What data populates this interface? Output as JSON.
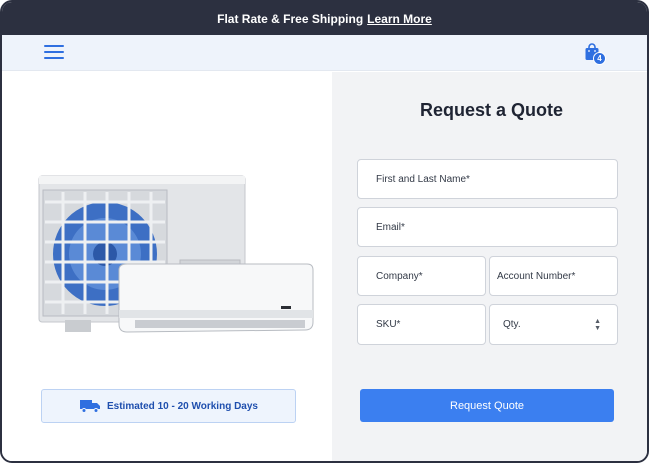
{
  "announcement": {
    "text": "Flat Rate & Free Shipping",
    "link": "Learn More"
  },
  "nav": {
    "menu_icon": "hamburger-menu-icon",
    "cart_icon": "shopping-bag-icon",
    "cart_count": "4",
    "accent_color": "#2f6fe0"
  },
  "product": {
    "image_icon": "air-conditioner-image",
    "delivery_icon": "delivery-truck-icon",
    "delivery_text": "Estimated 10 - 20  Working Days"
  },
  "form": {
    "title": "Request a Quote",
    "name_placeholder": "First and Last Name*",
    "email_placeholder": "Email*",
    "company_placeholder": "Company*",
    "account_placeholder": "Account Number*",
    "sku_placeholder": "SKU*",
    "qty_label": "Qty.",
    "submit_label": "Request Quote",
    "submit_color": "#3b7ff0"
  }
}
